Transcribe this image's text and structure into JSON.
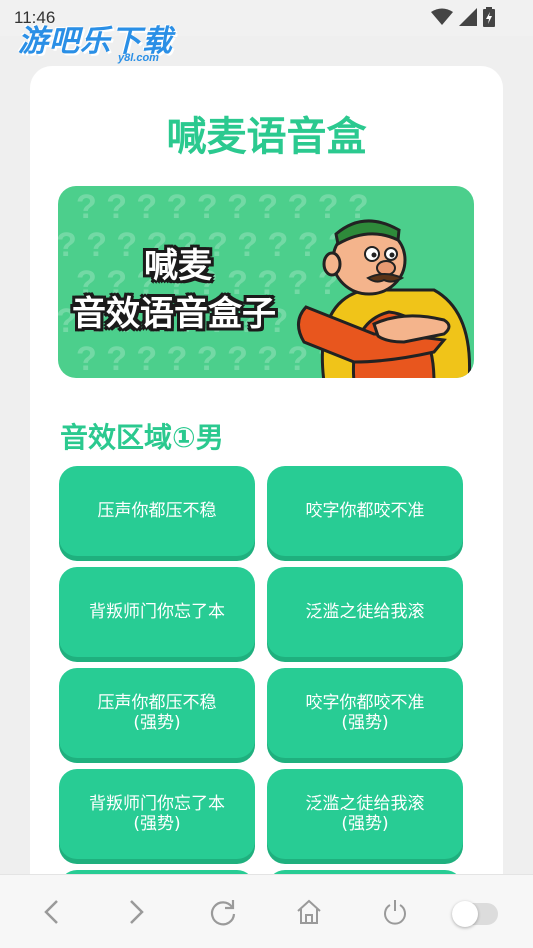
{
  "status_bar": {
    "time": "11:46"
  },
  "watermark": {
    "main": "游吧乐下载",
    "sub": "y8l.com"
  },
  "page": {
    "title": "喊麦语音盒"
  },
  "banner": {
    "line1": "喊麦",
    "line2": "音效语音盒子"
  },
  "section": {
    "title": "音效区域①男"
  },
  "sound_buttons": [
    {
      "label": "压声你都压不稳",
      "sub": ""
    },
    {
      "label": "咬字你都咬不准",
      "sub": ""
    },
    {
      "label": "背叛师门你忘了本",
      "sub": ""
    },
    {
      "label": "泛滥之徒给我滚",
      "sub": ""
    },
    {
      "label": "压声你都压不稳",
      "sub": "(强势)"
    },
    {
      "label": "咬字你都咬不准",
      "sub": "(强势)"
    },
    {
      "label": "背叛师门你忘了本",
      "sub": "(强势)"
    },
    {
      "label": "泛滥之徒给我滚",
      "sub": "(强势)"
    }
  ],
  "nav": {
    "back": "back-icon",
    "forward": "forward-icon",
    "refresh": "refresh-icon",
    "home": "home-icon",
    "power": "power-icon",
    "toggle": "toggle-switch"
  },
  "colors": {
    "accent": "#2bc98f",
    "button": "#28cc94",
    "banner": "#4ccf8c"
  }
}
